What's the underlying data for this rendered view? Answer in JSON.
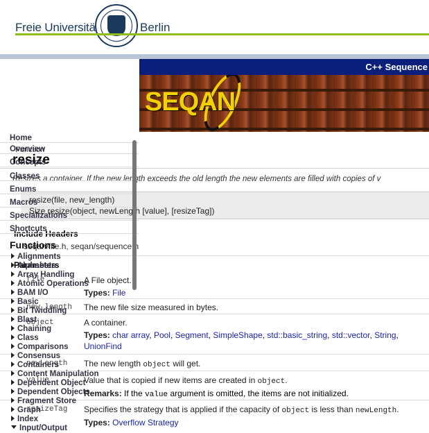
{
  "header": {
    "university_left": "Freie Universität",
    "university_right": "Berlin"
  },
  "banner": {
    "title": "C++ Sequence",
    "logo_text": "SEQAN"
  },
  "page": {
    "kind": "Function",
    "title": "resize",
    "summary": "Resizes a container. If the new length exceeds the old length the new elements are filled with copies of v",
    "signatures": [
      "resize(file, new_length)",
      "Size resize(object, newLength [value], [resizeTag])"
    ],
    "include_heading": "Include Headers",
    "include_value": "seqan/file.h, seqan/sequence.h",
    "parameters_heading": "Parameters",
    "parameters": [
      {
        "name": "file",
        "desc": "A File object.",
        "types_label": "Types:",
        "types": [
          "File"
        ]
      },
      {
        "name": "new_length",
        "desc": "The new file size measured in bytes."
      },
      {
        "name": "object",
        "desc": "A container.",
        "types_label": "Types:",
        "types": [
          "char array",
          "Pool",
          "Segment",
          "SimpleShape",
          "std::basic_string",
          "std::vector",
          "String"
        ],
        "types_cont": [
          "UnionFind"
        ]
      },
      {
        "name": "newLength",
        "desc_pre": "The new length",
        "desc_code": "object",
        "desc_post": "will get."
      },
      {
        "name": "value",
        "desc_pre": "Value that is copied if new items are created in",
        "desc_code": "object",
        "desc_post": ".",
        "remarks_label": "Remarks:",
        "remarks_pre": "If the",
        "remarks_code": "value",
        "remarks_post": "argument is omitted, the items are not initialized."
      },
      {
        "name": "resizeTag",
        "desc_pre": "Specifies the strategy that is applied if the capacity of",
        "desc_code": "object",
        "desc_mid": "is less than",
        "desc_code2": "newLength",
        "desc_post": ".",
        "types_label": "Types:",
        "types": [
          "Overflow Strategy"
        ]
      }
    ]
  },
  "nav": {
    "top_items": [
      "Home",
      "Overview",
      "Concepts",
      "Classes",
      "Enums",
      "Macros",
      "Specializations",
      "Shortcuts"
    ],
    "functions_heading": "Functions",
    "function_groups": [
      "Alignments",
      "Alphabets",
      "Array Handling",
      "Atomic Operations",
      "BAM I/O",
      "Basic",
      "Bit Twiddling",
      "Blast",
      "Chaining",
      "Class",
      "Comparisons",
      "Consensus",
      "Containers",
      "Content Manipulation",
      "Dependent Object",
      "Dependent Objects",
      "Fragment Store",
      "Graph",
      "Index",
      "Input/Output"
    ]
  }
}
